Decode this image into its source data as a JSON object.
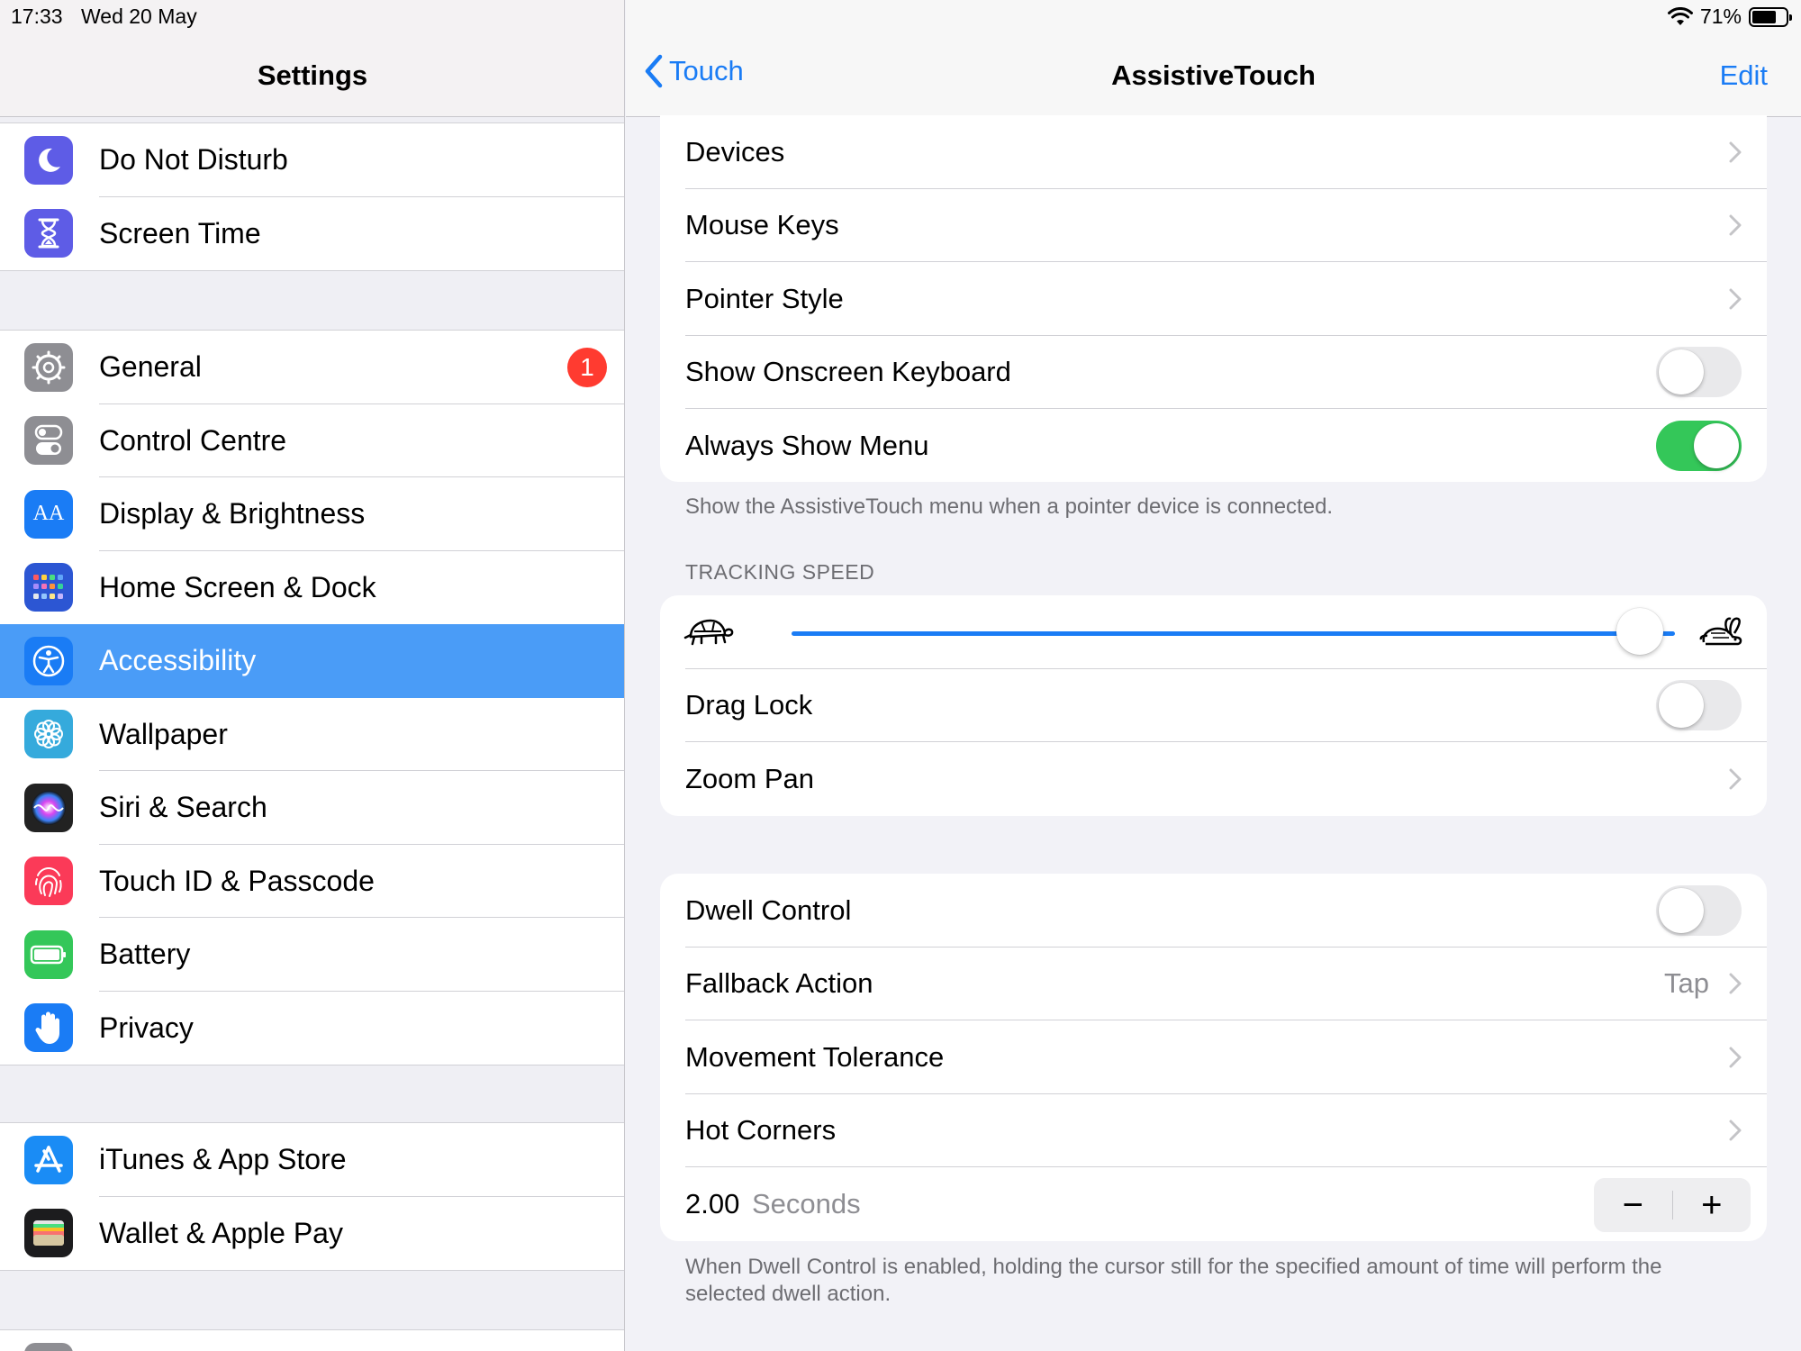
{
  "status": {
    "time": "17:33",
    "date": "Wed 20 May",
    "battery_pct": "71%",
    "battery_level": 0.71
  },
  "sidebar": {
    "title": "Settings",
    "group1": [
      {
        "label": "Do Not Disturb",
        "icon": "moon-icon",
        "color": "#5e5ce6"
      },
      {
        "label": "Screen Time",
        "icon": "hourglass-icon",
        "color": "#5e5ce6"
      }
    ],
    "group2": [
      {
        "label": "General",
        "icon": "gear-icon",
        "color": "#8e8e93",
        "badge": "1"
      },
      {
        "label": "Control Centre",
        "icon": "switches-icon",
        "color": "#8e8e93"
      },
      {
        "label": "Display & Brightness",
        "icon": "text-size-icon",
        "color": "#1a7cf5"
      },
      {
        "label": "Home Screen & Dock",
        "icon": "app-grid-icon",
        "color": "#2c56d3"
      },
      {
        "label": "Accessibility",
        "icon": "accessibility-icon",
        "color": "#1a7cf5",
        "selected": true
      },
      {
        "label": "Wallpaper",
        "icon": "flower-icon",
        "color": "#35aadc"
      },
      {
        "label": "Siri & Search",
        "icon": "siri-icon",
        "color": "#222222"
      },
      {
        "label": "Touch ID & Passcode",
        "icon": "fingerprint-icon",
        "color": "#fb3a58"
      },
      {
        "label": "Battery",
        "icon": "battery-icon",
        "color": "#34c759"
      },
      {
        "label": "Privacy",
        "icon": "hand-icon",
        "color": "#1a7cf5"
      }
    ],
    "group3": [
      {
        "label": "iTunes & App Store",
        "icon": "app-store-icon",
        "color": "#1a8cf5"
      },
      {
        "label": "Wallet & Apple Pay",
        "icon": "wallet-icon",
        "color": "#1c1c1e"
      }
    ]
  },
  "nav": {
    "back_label": "Touch",
    "title": "AssistiveTouch",
    "edit_label": "Edit"
  },
  "pointer_section": {
    "rows": [
      {
        "label": "Devices"
      },
      {
        "label": "Mouse Keys"
      },
      {
        "label": "Pointer Style"
      },
      {
        "label": "Show Onscreen Keyboard",
        "toggle": false
      },
      {
        "label": "Always Show Menu",
        "toggle": true
      }
    ],
    "footer": "Show the AssistiveTouch menu when a pointer device is connected."
  },
  "tracking": {
    "header": "TRACKING SPEED",
    "speed_value": 0.96,
    "rows": [
      {
        "label": "Drag Lock",
        "toggle": false
      },
      {
        "label": "Zoom Pan"
      }
    ]
  },
  "dwell": {
    "rows": [
      {
        "label": "Dwell Control",
        "toggle": false
      },
      {
        "label": "Fallback Action",
        "value": "Tap"
      },
      {
        "label": "Movement Tolerance"
      },
      {
        "label": "Hot Corners"
      }
    ],
    "seconds_value": "2.00",
    "seconds_unit": "Seconds",
    "minus": "−",
    "plus": "+",
    "footer": "When Dwell Control is enabled, holding the cursor still for the specified amount of time will perform the selected dwell action."
  },
  "colors": {
    "accent": "#1a7cf5",
    "toggle_on": "#34c759",
    "selected_row": "#4a9cf7"
  }
}
